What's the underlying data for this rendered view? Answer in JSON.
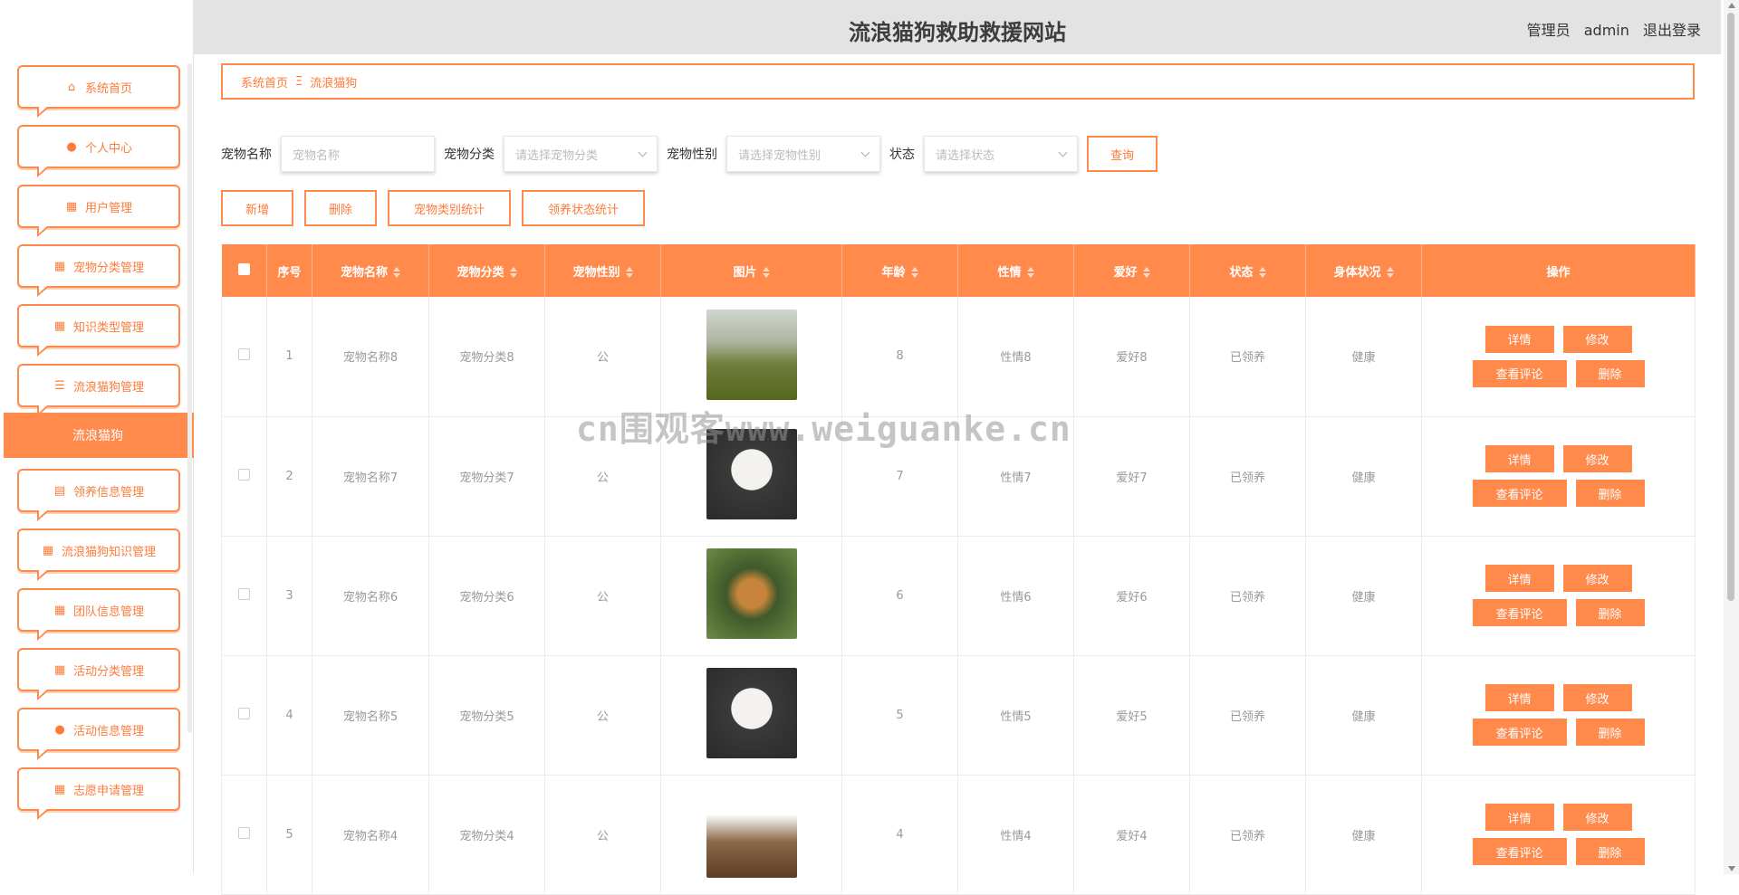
{
  "header": {
    "title": "流浪猫狗救助救援网站",
    "role": "管理员",
    "username": "admin",
    "logout": "退出登录"
  },
  "sidebar": {
    "items": [
      {
        "label": "系统首页",
        "icon": "home-icon",
        "glyph": "⌂"
      },
      {
        "label": "个人中心",
        "icon": "user-icon",
        "glyph": "●"
      },
      {
        "label": "用户管理",
        "icon": "grid-icon",
        "glyph": "▦"
      },
      {
        "label": "宠物分类管理",
        "icon": "grid-icon",
        "glyph": "▦"
      },
      {
        "label": "知识类型管理",
        "icon": "grid-icon",
        "glyph": "▦"
      },
      {
        "label": "流浪猫狗管理",
        "icon": "list-icon",
        "glyph": "☰"
      }
    ],
    "active": "流浪猫狗",
    "items2": [
      {
        "label": "领养信息管理",
        "icon": "clipboard-icon",
        "glyph": "▤"
      },
      {
        "label": "流浪猫狗知识管理",
        "icon": "grid-icon",
        "glyph": "▦"
      },
      {
        "label": "团队信息管理",
        "icon": "grid-icon",
        "glyph": "▦"
      },
      {
        "label": "活动分类管理",
        "icon": "grid-icon",
        "glyph": "▦"
      },
      {
        "label": "活动信息管理",
        "icon": "user-icon",
        "glyph": "●"
      },
      {
        "label": "志愿申请管理",
        "icon": "grid-icon",
        "glyph": "▦"
      }
    ]
  },
  "breadcrumb": {
    "home": "系统首页",
    "sep": "Ξ",
    "current": "流浪猫狗"
  },
  "search": {
    "name_label": "宠物名称",
    "name_placeholder": "宠物名称",
    "category_label": "宠物分类",
    "category_placeholder": "请选择宠物分类",
    "gender_label": "宠物性别",
    "gender_placeholder": "请选择宠物性别",
    "status_label": "状态",
    "status_placeholder": "请选择状态",
    "query": "查询"
  },
  "actions": {
    "add": "新增",
    "delete": "删除",
    "cat_stats": "宠物类别统计",
    "adopt_stats": "领养状态统计"
  },
  "table": {
    "headers": {
      "index": "序号",
      "name": "宠物名称",
      "category": "宠物分类",
      "gender": "宠物性别",
      "image": "图片",
      "age": "年龄",
      "temper": "性情",
      "hobby": "爱好",
      "status": "状态",
      "health": "身体状况",
      "ops": "操作"
    },
    "rows": [
      {
        "index": "1",
        "name": "宠物名称8",
        "category": "宠物分类8",
        "gender": "公",
        "age": "8",
        "temper": "性情8",
        "hobby": "爱好8",
        "status": "已领养",
        "health": "健康"
      },
      {
        "index": "2",
        "name": "宠物名称7",
        "category": "宠物分类7",
        "gender": "公",
        "age": "7",
        "temper": "性情7",
        "hobby": "爱好7",
        "status": "已领养",
        "health": "健康"
      },
      {
        "index": "3",
        "name": "宠物名称6",
        "category": "宠物分类6",
        "gender": "公",
        "age": "6",
        "temper": "性情6",
        "hobby": "爱好6",
        "status": "已领养",
        "health": "健康"
      },
      {
        "index": "4",
        "name": "宠物名称5",
        "category": "宠物分类5",
        "gender": "公",
        "age": "5",
        "temper": "性情5",
        "hobby": "爱好5",
        "status": "已领养",
        "health": "健康"
      },
      {
        "index": "5",
        "name": "宠物名称4",
        "category": "宠物分类4",
        "gender": "公",
        "age": "4",
        "temper": "性情4",
        "hobby": "爱好4",
        "status": "已领养",
        "health": "健康"
      }
    ],
    "ops": {
      "detail": "详情",
      "edit": "修改",
      "comments": "查看评论",
      "delete": "删除"
    }
  },
  "watermark": "cn围观客www.weiguanke.cn",
  "colors": {
    "accent": "#ff8a4c",
    "topbar": "#e3e3e3"
  }
}
